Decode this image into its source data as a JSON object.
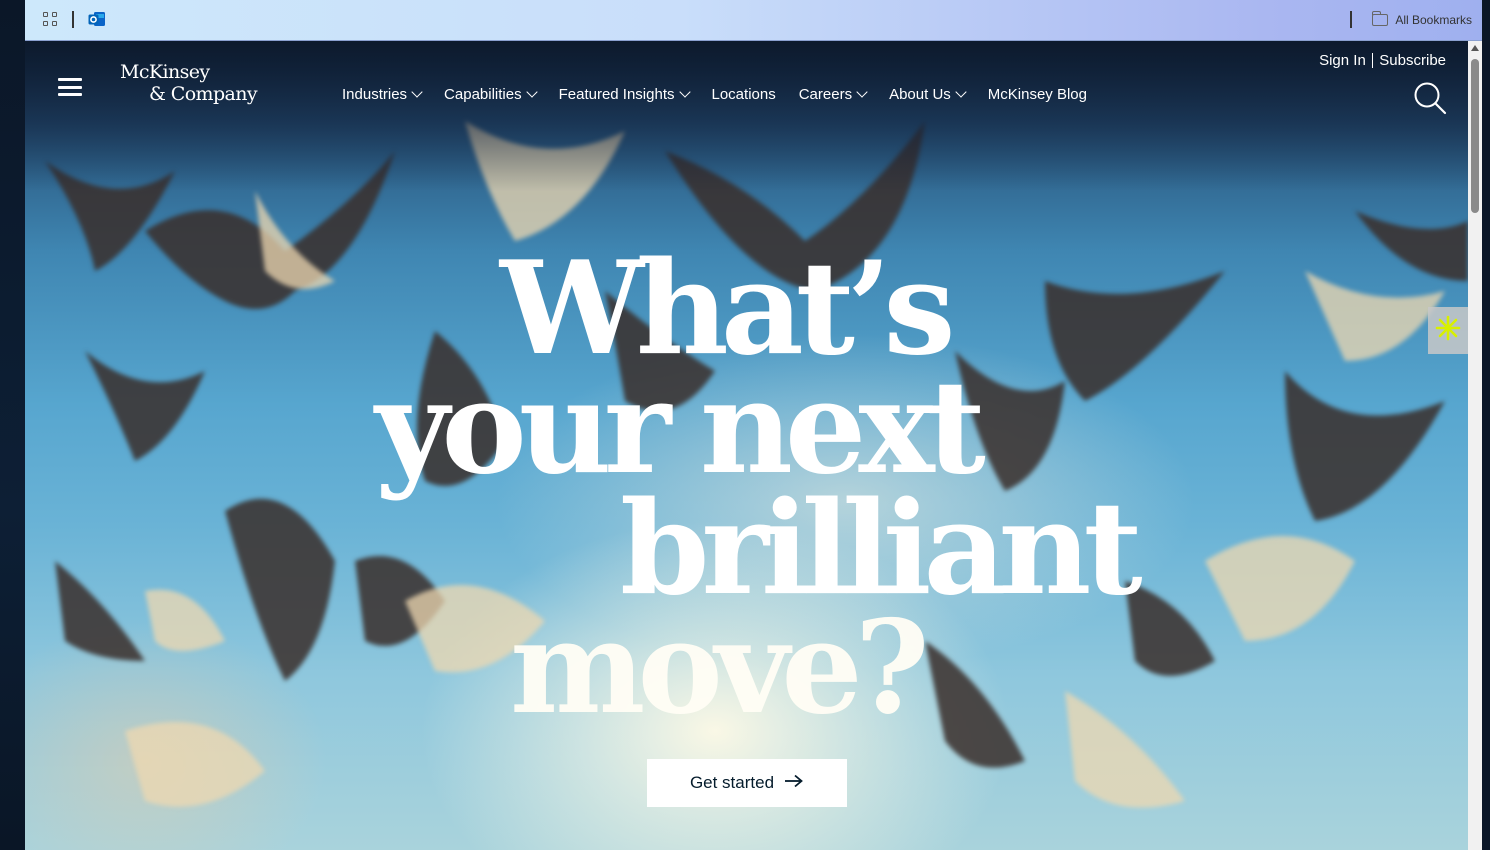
{
  "bookmarks_bar": {
    "apps_icon": "apps-grid-icon",
    "outlook_icon": "outlook-icon",
    "all_bookmarks_label": "All Bookmarks",
    "folder_icon": "folder-icon"
  },
  "site": {
    "logo_line1": "McKinsey",
    "logo_line2": "& Company",
    "menu_icon": "hamburger-menu-icon",
    "nav": [
      {
        "label": "Industries",
        "has_dropdown": true
      },
      {
        "label": "Capabilities",
        "has_dropdown": true
      },
      {
        "label": "Featured Insights",
        "has_dropdown": true
      },
      {
        "label": "Locations",
        "has_dropdown": false
      },
      {
        "label": "Careers",
        "has_dropdown": true
      },
      {
        "label": "About Us",
        "has_dropdown": true
      },
      {
        "label": "McKinsey Blog",
        "has_dropdown": false
      }
    ],
    "sign_in": "Sign In",
    "subscribe": "Subscribe",
    "search_icon": "search-icon"
  },
  "hero": {
    "headline_lines": [
      "What’s",
      "your next",
      "brilliant",
      "move?"
    ],
    "cta_label": "Get started",
    "cta_icon": "arrow-right-icon",
    "side_widget_icon": "asterisk-icon"
  },
  "colors": {
    "cta_text": "#051c2c",
    "widget_icon": "#d8f000"
  }
}
